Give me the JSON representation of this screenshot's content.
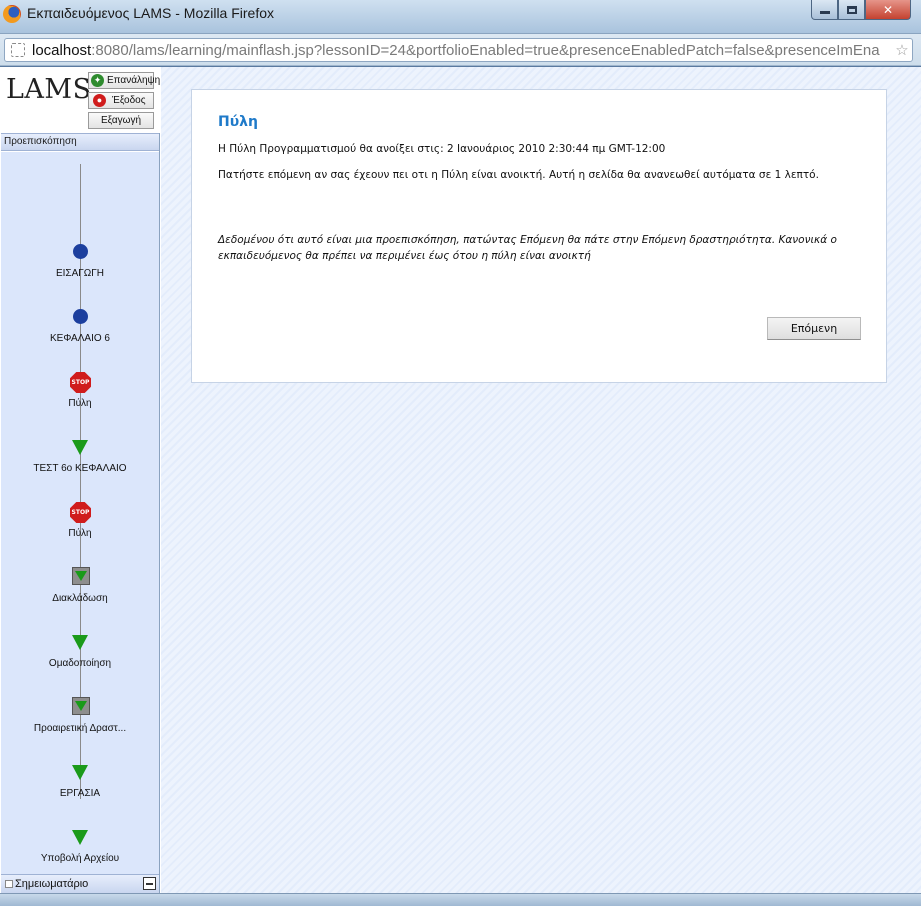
{
  "window": {
    "title": "Εκπαιδευόμενος LAMS - Mozilla Firefox"
  },
  "browser": {
    "url_host": "localhost",
    "url_rest": ":8080/lams/learning/mainflash.jsp?lessonID=24&portfolioEnabled=true&presenceEnabledPatch=false&presenceImEna"
  },
  "sidebar": {
    "logo": "LAMS",
    "buttons": {
      "repeat": "Επανάληψη",
      "exit": "Έξοδος",
      "export": "Εξαγωγή"
    },
    "preview_label": "Προεπισκόπηση",
    "activities": [
      {
        "label": "ΕΙΣΑΓΩΓΗ",
        "icon": "completed-circle-icon"
      },
      {
        "label": "ΚΕΦΑΛΑΙΟ 6",
        "icon": "completed-circle-icon"
      },
      {
        "label": "Πύλη",
        "icon": "stop-gate-icon"
      },
      {
        "label": "ΤΕΣΤ 6ο ΚΕΦΑΛΑΙΟ",
        "icon": "green-triangle-icon"
      },
      {
        "label": "Πύλη",
        "icon": "stop-gate-icon"
      },
      {
        "label": "Διακλάδωση",
        "icon": "branch-box-icon"
      },
      {
        "label": "Ομαδοποίηση",
        "icon": "green-triangle-icon"
      },
      {
        "label": "Προαιρετική Δραστ...",
        "icon": "optional-box-icon"
      },
      {
        "label": "ΕΡΓΑΣΙΑ",
        "icon": "green-triangle-icon"
      },
      {
        "label": "Υποβολή Αρχείου",
        "icon": "green-triangle-icon"
      }
    ],
    "notebook_label": "Σημειωματάριο"
  },
  "gate": {
    "title": "Πύλη",
    "opens_text": "Η Πύλη Προγραμματισμού θα ανοίξει στις: 2 Ιανουάριος 2010 2:30:44 πμ GMT-12:00",
    "instruction_text": "Πατήστε επόμενη αν σας έχεουν πει οτι η Πύλη είναι ανοικτή. Αυτή η σελίδα θα ανανεωθεί αυτόματα σε 1 λεπτό.",
    "preview_note": "Δεδομένου ότι αυτό είναι μια προεπισκόπηση, πατώντας Επόμενη θα πάτε στην Επόμενη δραστηριότητα. Κανονικά ο εκπαιδευόμενος θα πρέπει να περιμένει έως ότου η πύλη είναι ανοικτή",
    "next_button": "Επόμενη"
  },
  "colors": {
    "accent_title": "#1f7ac9",
    "completed_node": "#1c3f9e",
    "gate_stop": "#d01c1c",
    "activity_arrow": "#1a9a1a"
  }
}
